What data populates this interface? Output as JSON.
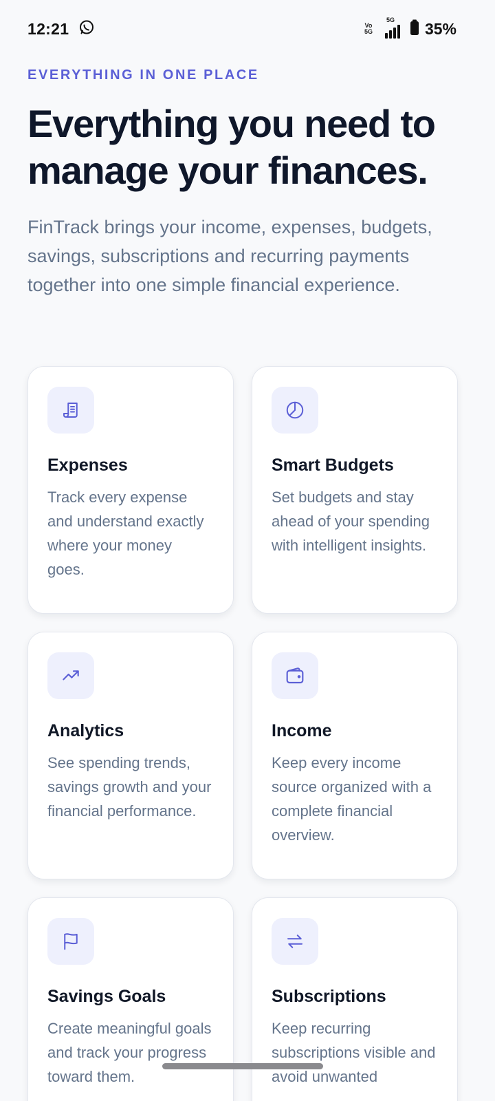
{
  "status_bar": {
    "time": "12:21",
    "network_top": "Vo",
    "network_bottom": "5G",
    "signal_label": "5G",
    "battery": "35%"
  },
  "hero": {
    "eyebrow": "EVERYTHING IN ONE PLACE",
    "headline": "Everything you need to manage your finances.",
    "intro": "FinTrack brings your income, expenses, budgets, savings, subscriptions and recurring payments together into one simple financial experience."
  },
  "features": [
    {
      "icon": "receipt-icon",
      "title": "Expenses",
      "description": "Track every expense and understand exactly where your money goes."
    },
    {
      "icon": "pie-chart-icon",
      "title": "Smart Budgets",
      "description": "Set budgets and stay ahead of your spending with intelligent insights."
    },
    {
      "icon": "trending-up-icon",
      "title": "Analytics",
      "description": "See spending trends, savings growth and your financial performance."
    },
    {
      "icon": "wallet-icon",
      "title": "Income",
      "description": "Keep every income source organized with a complete financial overview."
    },
    {
      "icon": "flag-icon",
      "title": "Savings Goals",
      "description": "Create meaningful goals and track your progress toward them."
    },
    {
      "icon": "repeat-icon",
      "title": "Subscriptions",
      "description": "Keep recurring subscriptions visible and avoid unwanted"
    }
  ],
  "colors": {
    "accent": "#5b5fd6",
    "icon_background": "#eef0fd",
    "heading": "#0f172a",
    "body_text": "#64748b",
    "page_background": "#f8f9fb"
  }
}
